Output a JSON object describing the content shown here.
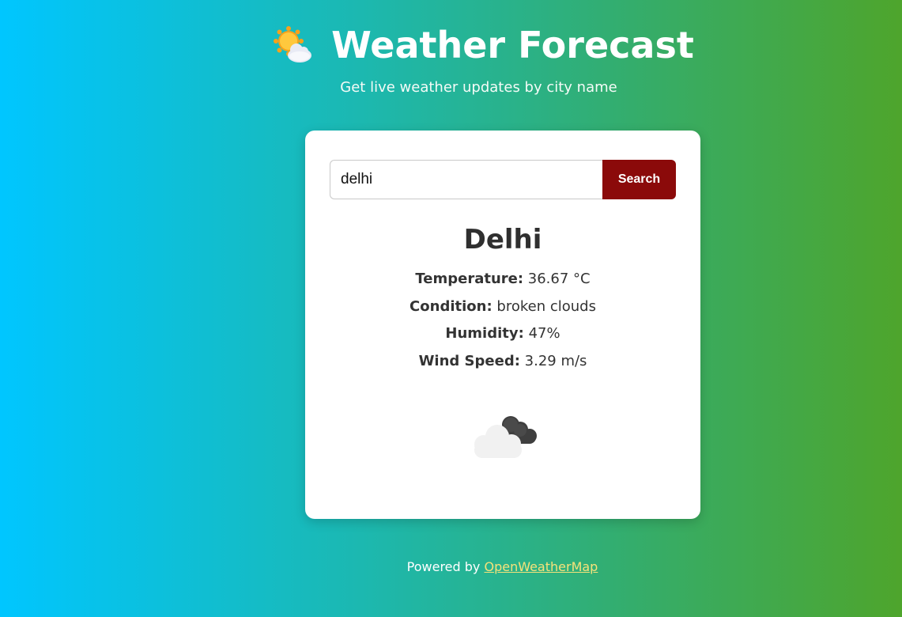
{
  "header": {
    "icon": "sun-behind-cloud-icon",
    "title": "Weather Forecast",
    "subtitle": "Get live weather updates by city name"
  },
  "search": {
    "value": "delhi",
    "button_label": "Search"
  },
  "result": {
    "city": "Delhi",
    "temperature_label": "Temperature:",
    "temperature_value": "36.67 °C",
    "condition_label": "Condition:",
    "condition_value": "broken clouds",
    "humidity_label": "Humidity:",
    "humidity_value": "47%",
    "wind_label": "Wind Speed:",
    "wind_value": "3.29 m/s",
    "icon": "broken-clouds-icon"
  },
  "footer": {
    "prefix": "Powered by",
    "link_text": "OpenWeatherMap"
  },
  "colors": {
    "gradient_start": "#00c6ff",
    "gradient_end": "#4ea52c",
    "button": "#8b0a0a",
    "link": "#f5e27a"
  }
}
